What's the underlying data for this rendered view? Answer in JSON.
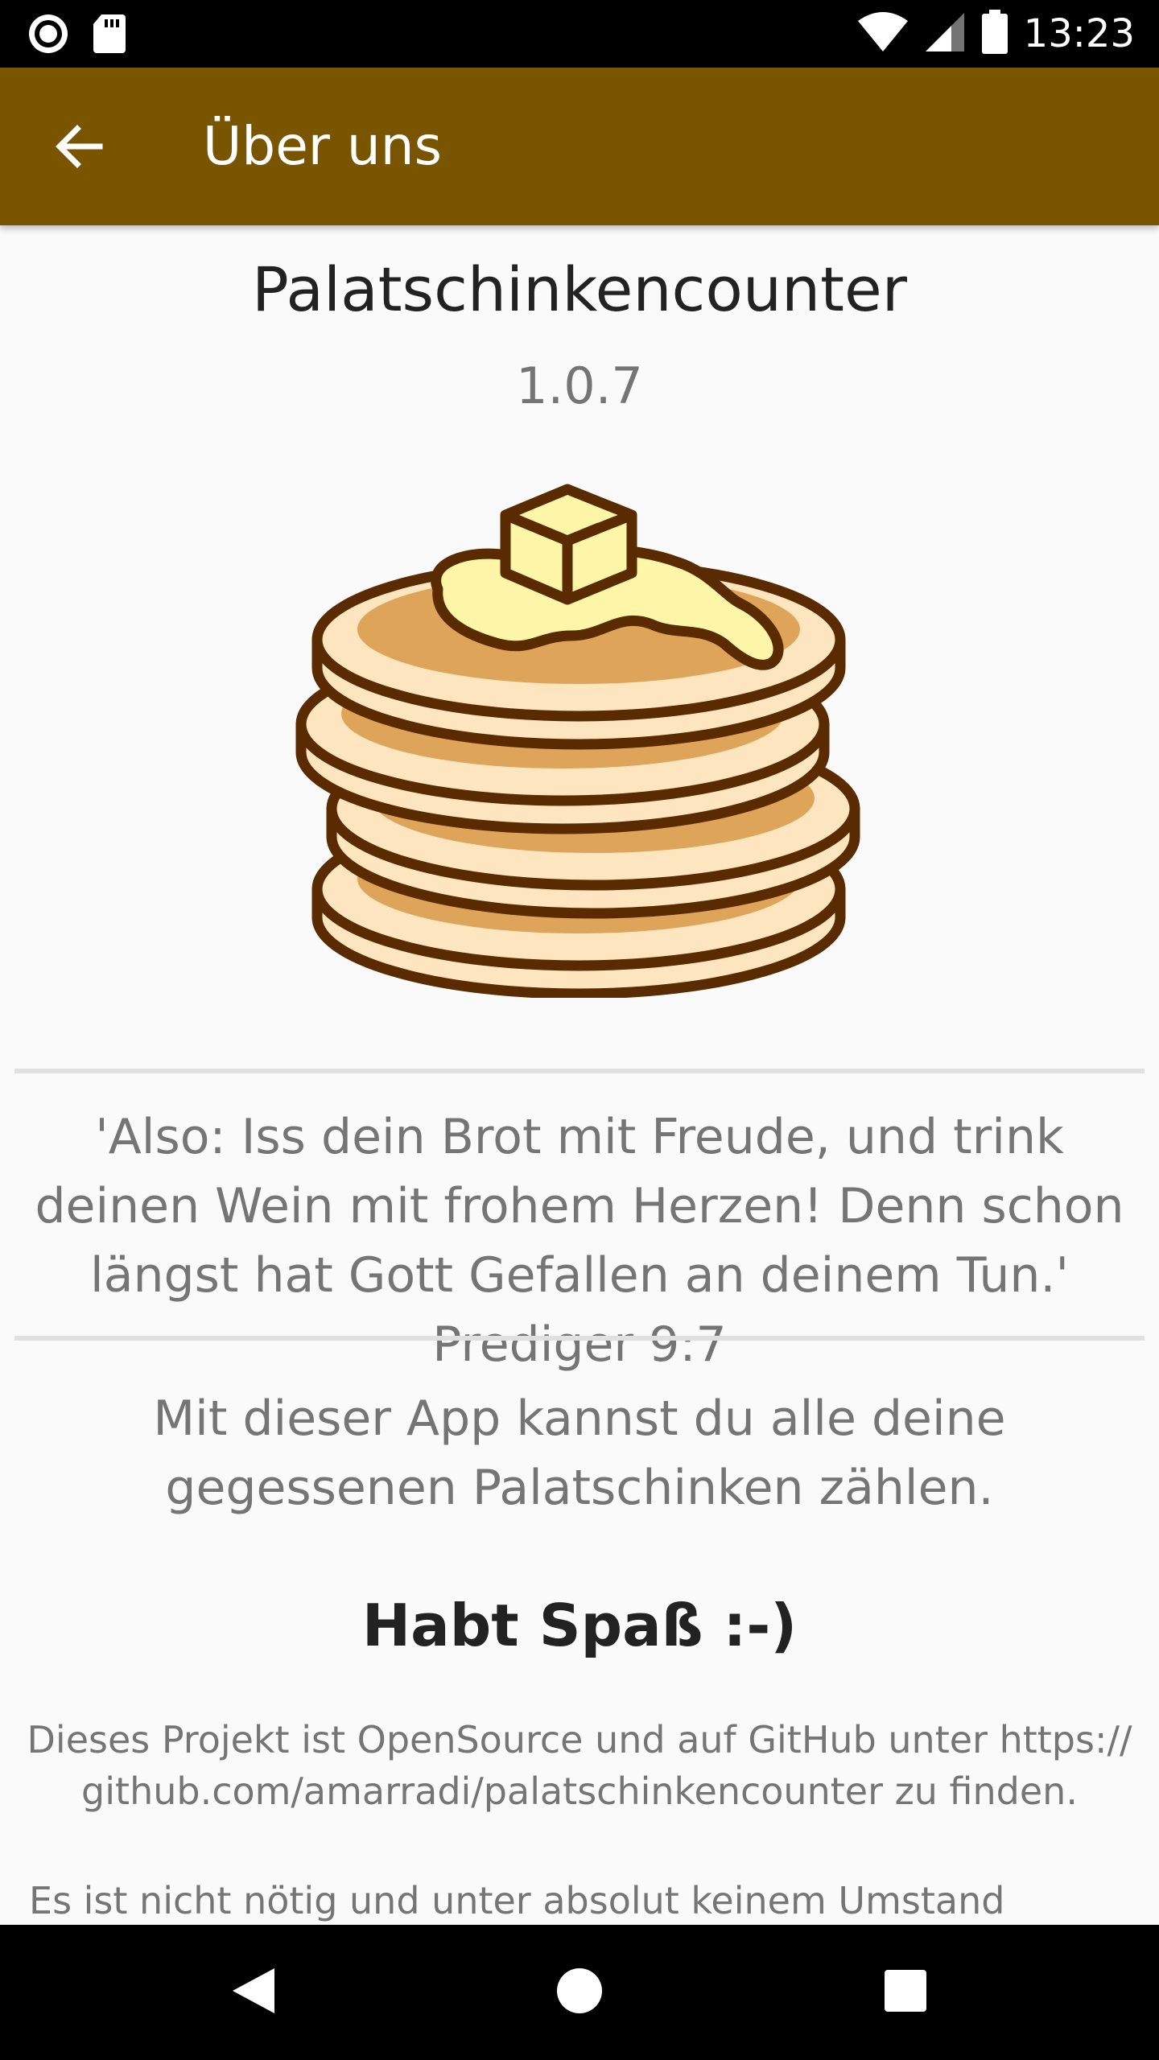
{
  "status_bar": {
    "time": "13:23",
    "left_icons": [
      "record-icon",
      "sd-card-icon"
    ],
    "right_icons": [
      "wifi-icon",
      "signal-icon",
      "battery-icon"
    ]
  },
  "app_bar": {
    "title": "Über uns",
    "back_icon": "arrow-back-icon",
    "color": "#7a5500"
  },
  "about": {
    "app_name": "Palatschinkencounter",
    "version": "1.0.7",
    "logo_icon": "pancake-stack-icon",
    "quote": "'Also: Iss dein Brot mit Freude, und trink deinen Wein mit frohem Herzen! Denn schon längst hat Gott Gefallen an deinem Tun.' Prediger 9:7",
    "description": "Mit dieser App kannst du alle deine gegessenen Palatschinken zählen.",
    "fun": "Habt Spaß :-)",
    "opensource": "Dieses Projekt ist OpenSource und auf GitHub unter https:// github.com/amarradi/palatschinkencounter zu finden.",
    "disclaimer": "Es ist nicht nötig und unter absolut keinem Umstand"
  },
  "nav_bar": {
    "back": "nav-back-icon",
    "home": "nav-home-icon",
    "recents": "nav-recents-icon"
  }
}
